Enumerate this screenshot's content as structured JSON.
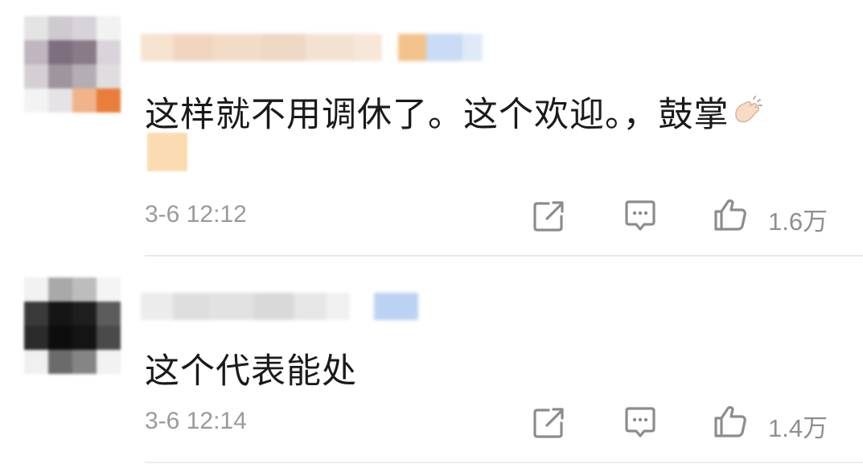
{
  "comments": [
    {
      "text": "这样就不用调休了。这个欢迎。，鼓掌",
      "emoji_icon": "clapping-hands-icon",
      "timestamp": "3-6 12:12",
      "likes": "1.6万"
    },
    {
      "text": "这个代表能处",
      "timestamp": "3-6 12:14",
      "likes": "1.4万"
    }
  ],
  "colors": {
    "text": "#1a1a1a",
    "meta": "#9a9a9a",
    "icon": "#8c8c8c",
    "divider": "#e9e9e9"
  }
}
